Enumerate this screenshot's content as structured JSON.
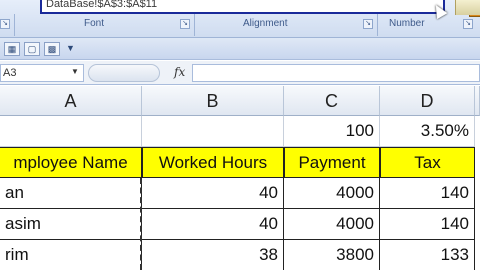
{
  "ribbon": {
    "dialog_text": "DataBase!$A$3:$A$11",
    "groups": [
      "Font",
      "Alignment",
      "Number"
    ]
  },
  "name_box": {
    "value": "A3"
  },
  "formula_bar": {
    "fx_label": "fx"
  },
  "columns": [
    "A",
    "B",
    "C",
    "D"
  ],
  "rates_row": {
    "c": "100",
    "d": "3.50%"
  },
  "headers": [
    "mployee Name",
    "Worked Hours",
    "Payment",
    "Tax"
  ],
  "rows": [
    [
      "an",
      "40",
      "4000",
      "140"
    ],
    [
      "asim",
      "40",
      "4000",
      "140"
    ],
    [
      "rim",
      "38",
      "3800",
      "133"
    ]
  ]
}
